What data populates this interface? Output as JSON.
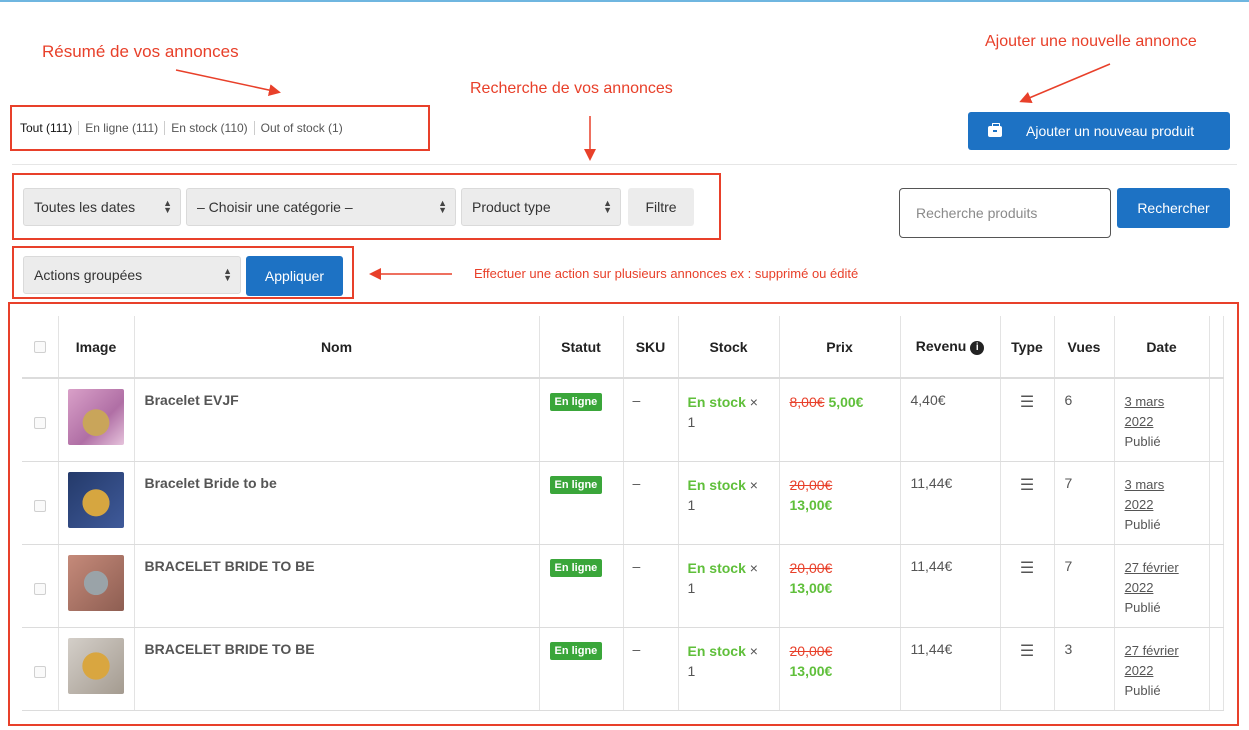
{
  "annotations": {
    "summary": "Résumé de vos annonces",
    "add_new": "Ajouter une nouvelle annonce",
    "search": "Recherche de vos annonces",
    "bulk": "Effectuer une action sur plusieurs annonces ex : supprimé ou édité"
  },
  "filters": [
    {
      "label": "Tout (111)"
    },
    {
      "label": "En ligne (111)"
    },
    {
      "label": "En stock (110)"
    },
    {
      "label": "Out of stock (1)"
    }
  ],
  "add_button": {
    "label": "Ajouter un nouveau produit",
    "icon": "briefcase-icon"
  },
  "search_bar": {
    "dates": "Toutes les dates",
    "category": "– Choisir une catégorie –",
    "product_type": "Product type",
    "filter": "Filtre",
    "search_placeholder": "Recherche produits",
    "search_button": "Rechercher"
  },
  "bulk_actions": {
    "select": "Actions groupées",
    "apply": "Appliquer"
  },
  "table": {
    "headers": {
      "image": "Image",
      "name": "Nom",
      "status": "Statut",
      "sku": "SKU",
      "stock": "Stock",
      "price": "Prix",
      "revenue": "Revenu",
      "type": "Type",
      "views": "Vues",
      "date": "Date"
    },
    "rows": [
      {
        "name": "Bracelet EVJF",
        "status": "En ligne",
        "sku": "–",
        "stock": "En stock",
        "stock_x": "×",
        "stock_qty": "1",
        "old_price": "8,00€",
        "price": "5,00€",
        "revenue": "4,40€",
        "views": "6",
        "date_line1": "3 mars",
        "date_line2": "2022",
        "published": "Publié"
      },
      {
        "name": "Bracelet Bride to be",
        "status": "En ligne",
        "sku": "–",
        "stock": "En stock",
        "stock_x": "×",
        "stock_qty": "1",
        "old_price": "20,00€",
        "price": "13,00€",
        "revenue": "11,44€",
        "views": "7",
        "date_line1": "3 mars",
        "date_line2": "2022",
        "published": "Publié"
      },
      {
        "name": "BRACELET BRIDE TO BE",
        "status": "En ligne",
        "sku": "–",
        "stock": "En stock",
        "stock_x": "×",
        "stock_qty": "1",
        "old_price": "20,00€",
        "price": "13,00€",
        "revenue": "11,44€",
        "views": "7",
        "date_line1": "27 février",
        "date_line2": "2022",
        "published": "Publié"
      },
      {
        "name": "BRACELET BRIDE TO BE",
        "status": "En ligne",
        "sku": "–",
        "stock": "En stock",
        "stock_x": "×",
        "stock_qty": "1",
        "old_price": "20,00€",
        "price": "13,00€",
        "revenue": "11,44€",
        "views": "3",
        "date_line1": "27 février",
        "date_line2": "2022",
        "published": "Publié"
      }
    ]
  },
  "colors": {
    "accent_blue": "#1d72c4",
    "annotation_red": "#e8402a",
    "in_stock_green": "#5fbf3a",
    "badge_green": "#3aa63a"
  }
}
